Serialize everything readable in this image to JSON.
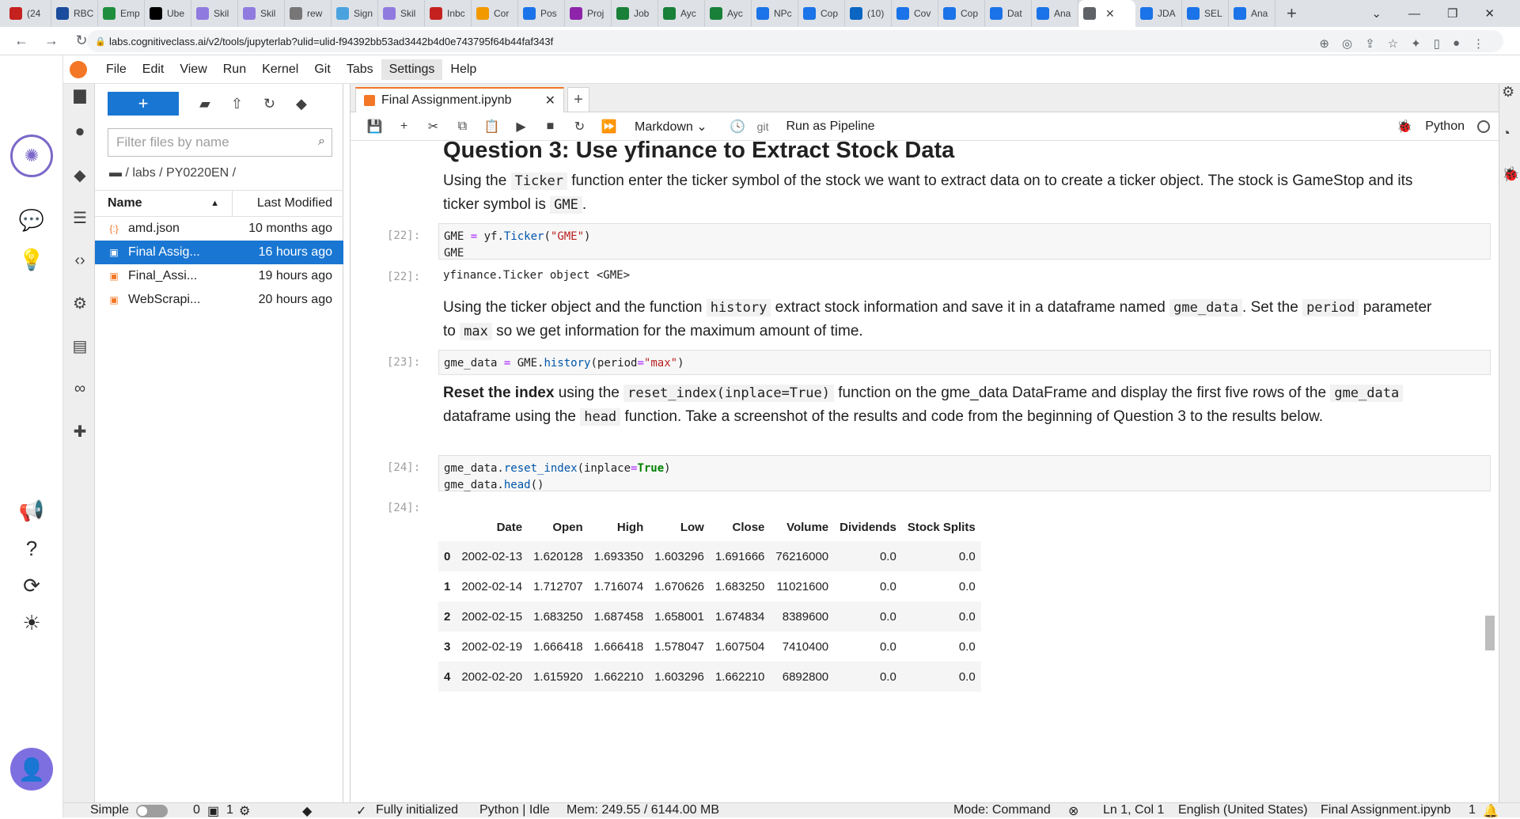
{
  "browser": {
    "tabs": [
      {
        "label": "(24",
        "icon": "gmail-icon",
        "color": "#c5221f"
      },
      {
        "label": "RBC",
        "icon": "rbc-icon",
        "color": "#1a4b9c"
      },
      {
        "label": "Emp",
        "icon": "emp-icon",
        "color": "#1e8e3e"
      },
      {
        "label": "Ube",
        "icon": "uber-icon",
        "color": "#000000"
      },
      {
        "label": "Skil",
        "icon": "skills-icon",
        "color": "#8f7be0"
      },
      {
        "label": "Skil",
        "icon": "skills-icon",
        "color": "#8f7be0"
      },
      {
        "label": "rew",
        "icon": "rewards-icon",
        "color": "#777777"
      },
      {
        "label": "Sign",
        "icon": "cloud-icon",
        "color": "#4aa3df"
      },
      {
        "label": "Skil",
        "icon": "skills-icon",
        "color": "#8f7be0"
      },
      {
        "label": "Inbc",
        "icon": "gmail-icon",
        "color": "#c5221f"
      },
      {
        "label": "Cor",
        "icon": "cor-icon",
        "color": "#f29900"
      },
      {
        "label": "Pos",
        "icon": "z-icon",
        "color": "#1a73e8"
      },
      {
        "label": "Proj",
        "icon": "proj-icon",
        "color": "#8e24aa"
      },
      {
        "label": "Job",
        "icon": "plus-icon",
        "color": "#188038"
      },
      {
        "label": "Ayc",
        "icon": "plus-icon",
        "color": "#188038"
      },
      {
        "label": "Ayc",
        "icon": "plus-icon",
        "color": "#188038"
      },
      {
        "label": "NPc",
        "icon": "doc-icon",
        "color": "#1a73e8"
      },
      {
        "label": "Cop",
        "icon": "doc-icon",
        "color": "#1a73e8"
      },
      {
        "label": "(10)",
        "icon": "linkedin-icon",
        "color": "#0a66c2"
      },
      {
        "label": "Cov",
        "icon": "doc-icon",
        "color": "#1a73e8"
      },
      {
        "label": "Cop",
        "icon": "doc-icon",
        "color": "#1a73e8"
      },
      {
        "label": "Dat",
        "icon": "c-icon",
        "color": "#1a73e8"
      },
      {
        "label": "Ana",
        "icon": "c-icon",
        "color": "#1a73e8"
      },
      {
        "label": "",
        "icon": "globe-icon",
        "color": "#5f6368",
        "active": true
      },
      {
        "label": "JDA",
        "icon": "c-icon",
        "color": "#1a73e8"
      },
      {
        "label": "SEL",
        "icon": "c-icon",
        "color": "#1a73e8"
      },
      {
        "label": "Ana",
        "icon": "c-icon",
        "color": "#1a73e8"
      }
    ],
    "url": "labs.cognitiveclass.ai/v2/tools/jupyterlab?ulid=ulid-f94392bb53ad3442b4d0e743795f64b44faf343f"
  },
  "menu": [
    "File",
    "Edit",
    "View",
    "Run",
    "Kernel",
    "Git",
    "Tabs",
    "Settings",
    "Help"
  ],
  "filebrowser": {
    "filter_placeholder": "Filter files by name",
    "breadcrumb": "/ labs / PY0220EN /",
    "col_name": "Name",
    "col_modified": "Last Modified",
    "files": [
      {
        "icon": "{:}",
        "name": "amd.json",
        "modified": "10 months ago",
        "selected": false
      },
      {
        "icon": "▣",
        "name": "Final Assig...",
        "modified": "16 hours ago",
        "selected": true
      },
      {
        "icon": "▣",
        "name": "Final_Assi...",
        "modified": "19 hours ago",
        "selected": false
      },
      {
        "icon": "▣",
        "name": "WebScrapi...",
        "modified": "20 hours ago",
        "selected": false
      }
    ]
  },
  "notebook": {
    "tab_title": "Final Assignment.ipynb",
    "cell_type": "Markdown",
    "git_label": "git",
    "pipeline_label": "Run as Pipeline",
    "kernel_name": "Python",
    "heading": "Question 3: Use yfinance to Extract Stock Data",
    "md1": {
      "p1": "Using the ",
      "c1": "Ticker",
      "p2": " function enter the ticker symbol of the stock we want to extract data on to create a ticker object. The stock is GameStop and its ticker symbol is ",
      "c2": "GME",
      "p3": "."
    },
    "cell22": {
      "prompt": "[22]:",
      "out_prompt": "[22]:",
      "line2": "GME",
      "output": "yfinance.Ticker object <GME>"
    },
    "md2": {
      "p1": "Using the ticker object and the function ",
      "c1": "history",
      "p2": " extract stock information and save it in a dataframe named ",
      "c2": "gme_data",
      "p3": ". Set the ",
      "c3": "period",
      "p4": " parameter to ",
      "c4": "max",
      "p5": " so we get information for the maximum amount of time."
    },
    "cell23": {
      "prompt": "[23]:"
    },
    "md3": {
      "b1": "Reset the index",
      "p1": " using the ",
      "c1": "reset_index(inplace=True)",
      "p2": " function on the gme_data DataFrame and display the first five rows of the ",
      "c2": "gme_data",
      "p3": " dataframe using the ",
      "c3": "head",
      "p4": " function. Take a screenshot of the results and code from the beginning of Question 3 to the results below."
    },
    "cell24": {
      "prompt": "[24]:",
      "out_prompt": "[24]:"
    },
    "table": {
      "columns": [
        "",
        "Date",
        "Open",
        "High",
        "Low",
        "Close",
        "Volume",
        "Dividends",
        "Stock Splits"
      ],
      "rows": [
        [
          "0",
          "2002-02-13",
          "1.620128",
          "1.693350",
          "1.603296",
          "1.691666",
          "76216000",
          "0.0",
          "0.0"
        ],
        [
          "1",
          "2002-02-14",
          "1.712707",
          "1.716074",
          "1.670626",
          "1.683250",
          "11021600",
          "0.0",
          "0.0"
        ],
        [
          "2",
          "2002-02-15",
          "1.683250",
          "1.687458",
          "1.658001",
          "1.674834",
          "8389600",
          "0.0",
          "0.0"
        ],
        [
          "3",
          "2002-02-19",
          "1.666418",
          "1.666418",
          "1.578047",
          "1.607504",
          "7410400",
          "0.0",
          "0.0"
        ],
        [
          "4",
          "2002-02-20",
          "1.615920",
          "1.662210",
          "1.603296",
          "1.662210",
          "6892800",
          "0.0",
          "0.0"
        ]
      ]
    }
  },
  "status": {
    "simple": "Simple",
    "zero": "0",
    "one": "1",
    "initialized": "Fully initialized",
    "kernel": "Python | Idle",
    "mem": "Mem: 249.55 / 6144.00 MB",
    "mode": "Mode: Command",
    "pos": "Ln 1, Col 1",
    "lang": "English (United States)",
    "file": "Final Assignment.ipynb",
    "count": "1"
  }
}
